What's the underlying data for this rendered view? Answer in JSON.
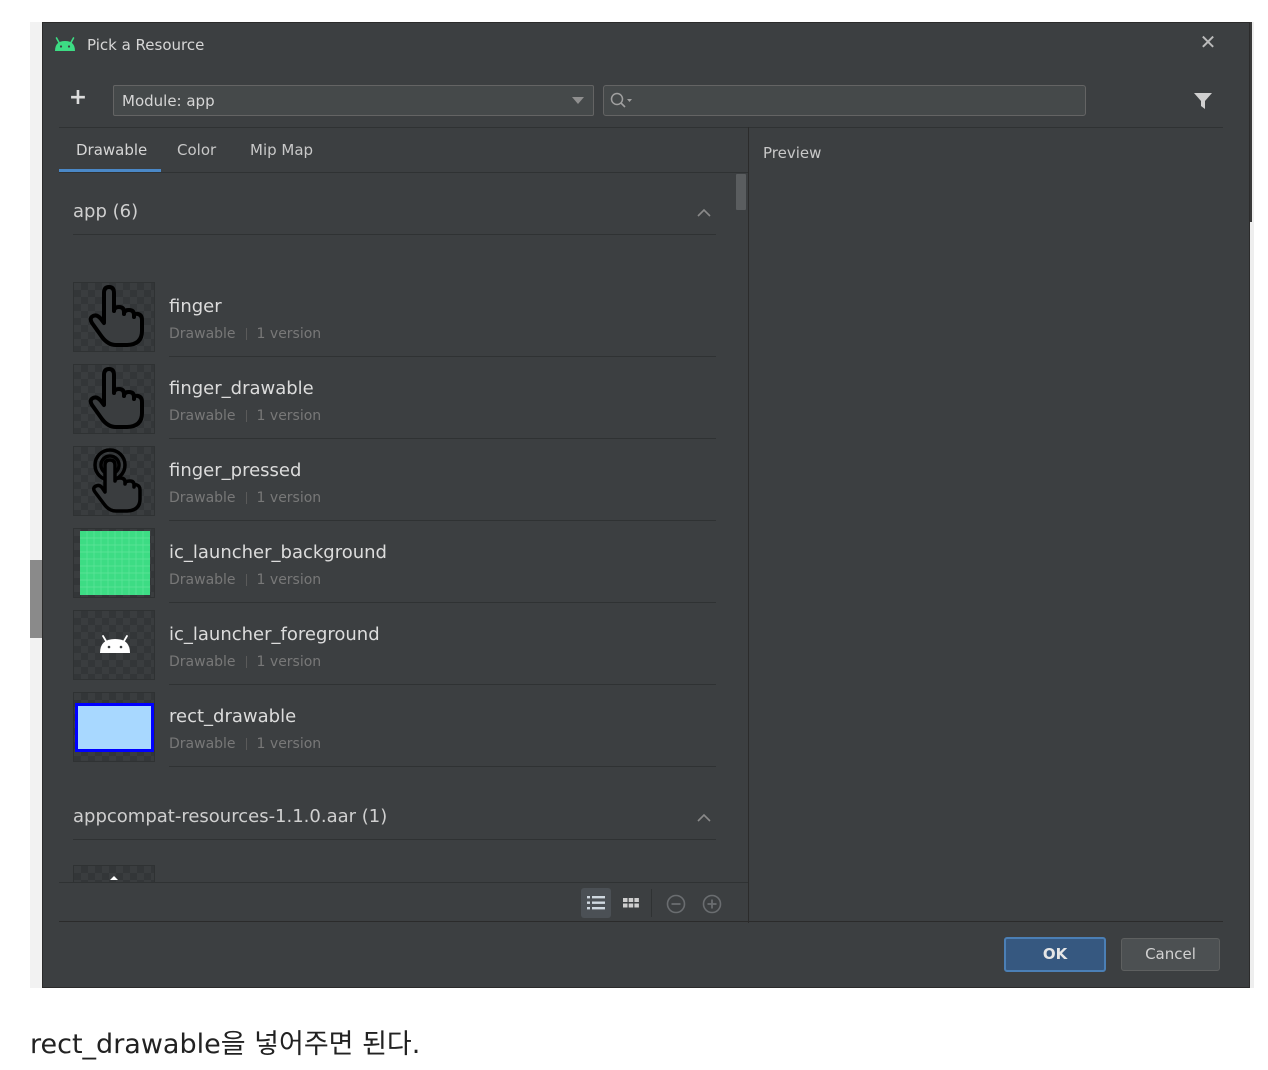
{
  "dialog": {
    "title": "Pick a Resource",
    "icons": {
      "app": "android-icon",
      "close": "close-icon"
    },
    "toolbar": {
      "add_label": "+",
      "module_value": "Module: app",
      "search_value": "",
      "search_placeholder": ""
    },
    "tabs": [
      {
        "label": "Drawable",
        "active": true
      },
      {
        "label": "Color",
        "active": false
      },
      {
        "label": "Mip Map",
        "active": false
      }
    ],
    "sections": [
      {
        "name": "app",
        "count": "(6)",
        "items": [
          {
            "name": "finger",
            "type": "Drawable",
            "versions": "1 version",
            "thumb": "hand-pointer-icon"
          },
          {
            "name": "finger_drawable",
            "type": "Drawable",
            "versions": "1 version",
            "thumb": "hand-pointer-icon"
          },
          {
            "name": "finger_pressed",
            "type": "Drawable",
            "versions": "1 version",
            "thumb": "hand-pressed-icon"
          },
          {
            "name": "ic_launcher_background",
            "type": "Drawable",
            "versions": "1 version",
            "thumb": "green-grid-image"
          },
          {
            "name": "ic_launcher_foreground",
            "type": "Drawable",
            "versions": "1 version",
            "thumb": "android-head-icon"
          },
          {
            "name": "rect_drawable",
            "type": "Drawable",
            "versions": "1 version",
            "thumb": "blue-rectangle-image"
          }
        ]
      },
      {
        "name": "appcompat-resources-1.1.0.aar",
        "count": "(1)",
        "items": []
      }
    ],
    "preview_label": "Preview",
    "buttons": {
      "ok": "OK",
      "cancel": "Cancel"
    },
    "colors": {
      "dialog_bg": "#3c3f41",
      "accent": "#4a88c7",
      "ok_bg": "#365880",
      "launcher_green": "#3ddc84",
      "rect_fill": "#a8d8ff",
      "rect_border": "#0000ff"
    }
  },
  "caption": "rect_drawable을 넣어주면 된다."
}
